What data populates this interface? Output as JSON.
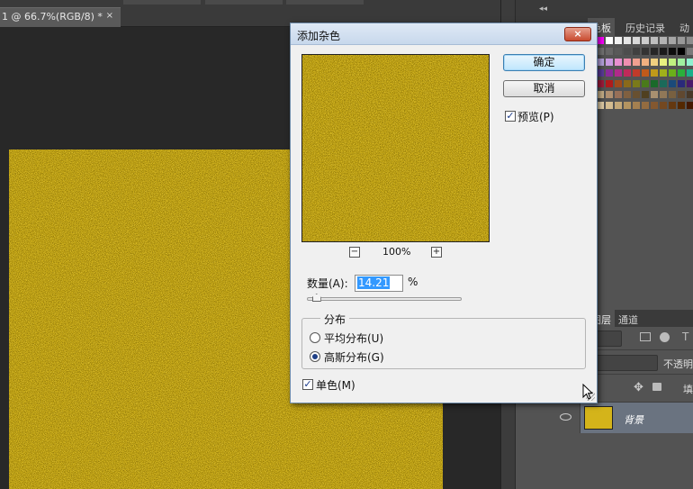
{
  "document_tab": {
    "title": "1 @ 66.7%(RGB/8) *",
    "close": "×"
  },
  "panel_top": {
    "collapse": "◂◂"
  },
  "panel_tabs": [
    {
      "label": "色板",
      "active": true
    },
    {
      "label": "历史记录",
      "active": false
    },
    {
      "label": "动",
      "active": false
    }
  ],
  "swatch_colors": [
    [
      "#0000ff",
      "#ff00ff",
      "#ffffff",
      "#f2f2f2",
      "#e6e6e6",
      "#d9d9d9",
      "#cccccc",
      "#bfbfbf",
      "#b3b3b3",
      "#a6a6a6",
      "#999999",
      "#8c8c8c"
    ],
    [
      "#808080",
      "#737373",
      "#666666",
      "#595959",
      "#4d4d4d",
      "#404040",
      "#333333",
      "#262626",
      "#1a1a1a",
      "#0d0d0d",
      "#000000",
      "#7a7a7a"
    ],
    [
      "#8fd4f0",
      "#b7a4e0",
      "#c89ae0",
      "#e88fd0",
      "#f08fb0",
      "#f0a090",
      "#f0b080",
      "#f0d080",
      "#e8f080",
      "#c0f080",
      "#a0f0a0",
      "#90f0d0"
    ],
    [
      "#3a6fb0",
      "#5a3a9a",
      "#8a2a9a",
      "#b02a8a",
      "#c02a5a",
      "#c03a2a",
      "#c05a1a",
      "#c09a1a",
      "#a0b01a",
      "#6ab01a",
      "#2ab03a",
      "#1ab08a"
    ],
    [
      "#8a1a5a",
      "#a01a3a",
      "#b01a1a",
      "#a04a1a",
      "#8a6a1a",
      "#7a7a1a",
      "#4a7a1a",
      "#1a6a2a",
      "#1a6a5a",
      "#1a4a7a",
      "#2a2a7a",
      "#4a1a6a"
    ],
    [
      "#d8c8a8",
      "#c8b088",
      "#b09070",
      "#987058",
      "#806040",
      "#685030",
      "#504020",
      "#a89070",
      "#907858",
      "#786040",
      "#604830",
      "#483828"
    ],
    [
      "#f4e4c4",
      "#e4d0a8",
      "#d4bc90",
      "#c4a878",
      "#b49460",
      "#a48050",
      "#946c40",
      "#845830",
      "#744820",
      "#643810",
      "#542800",
      "#441800"
    ]
  ],
  "layers_tabs": [
    {
      "label": "图层",
      "active": true
    },
    {
      "label": "通道",
      "active": false
    }
  ],
  "layers": {
    "opacity_label": "不透明",
    "fill_label": "填",
    "background_layer_name": "背景"
  },
  "dialog": {
    "title": "添加杂色",
    "close_glyph": "×",
    "ok_label": "确定",
    "cancel_label": "取消",
    "preview_label": "预览(P)",
    "preview_checked": true,
    "zoom_minus": "−",
    "zoom_plus": "+",
    "zoom_level": "100%",
    "amount_label": "数量(A):",
    "amount_value": "14.21",
    "amount_unit": "%",
    "amount_slider_fraction": 0.0356,
    "distribution_title": "分布",
    "uniform_label": "平均分布(U)",
    "gaussian_label": "高斯分布(G)",
    "selected_distribution": "gaussian",
    "monochromatic_label": "单色(M)",
    "monochromatic_checked": true
  },
  "colors": {
    "noise_base": "#d4b41a",
    "noise_dark": "#6b5708",
    "noise_light": "#f7e36a"
  }
}
